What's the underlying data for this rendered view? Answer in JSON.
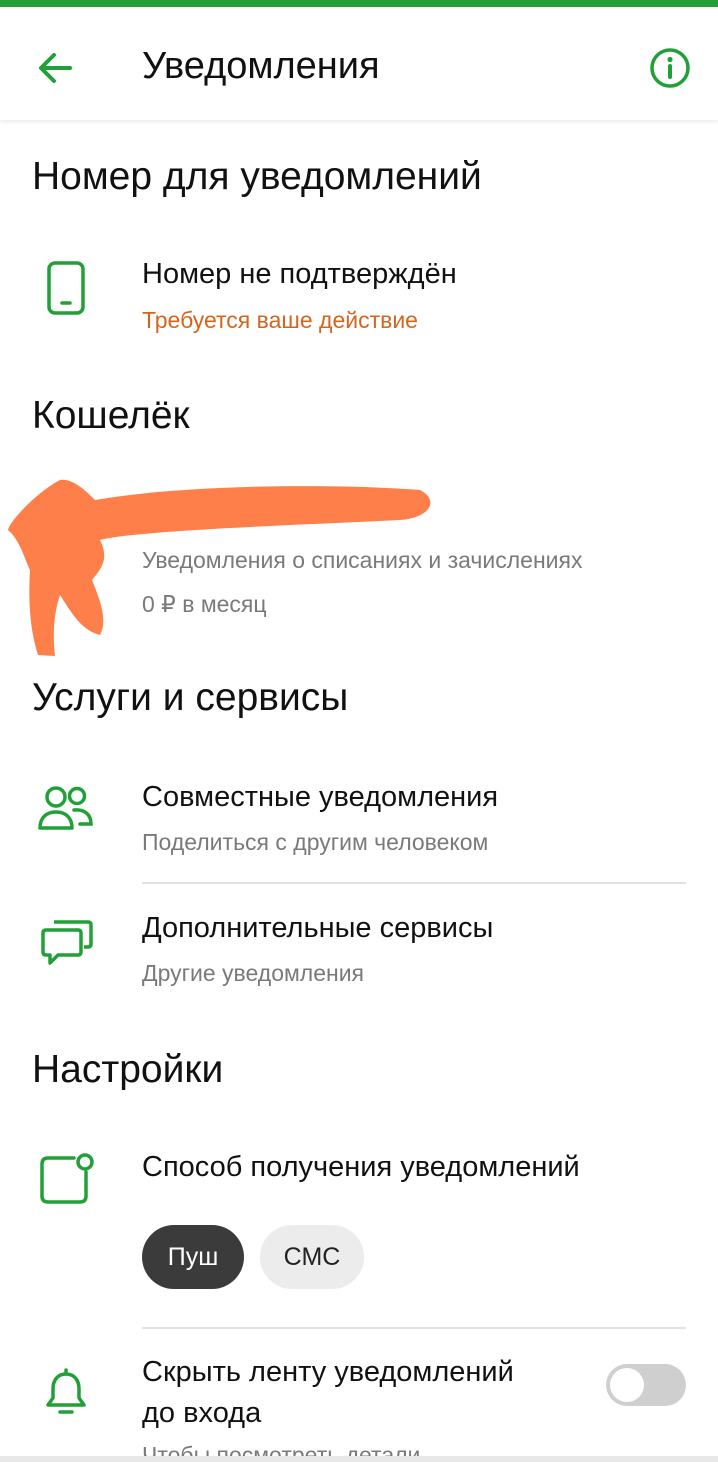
{
  "header": {
    "title": "Уведомления"
  },
  "colors": {
    "accent": "#21a038",
    "warning": "#d3661f",
    "scribble": "#ff7f4a"
  },
  "sections": {
    "phone": {
      "title": "Номер для уведомлений",
      "row_title": "Номер не подтверждён",
      "row_sub": "Требуется ваше действие",
      "icon": "phone-icon"
    },
    "wallet": {
      "title": "Кошелёк",
      "row_sub": "Уведомления о списаниях и зачислениях",
      "row_price": "0 ₽ в месяц"
    },
    "services": {
      "title": "Услуги и сервисы",
      "items": [
        {
          "title": "Совместные уведомления",
          "sub": "Поделиться с другим человеком",
          "icon": "users-icon"
        },
        {
          "title": "Дополнительные сервисы",
          "sub": "Другие уведомления",
          "icon": "chat-icon"
        }
      ]
    },
    "settings": {
      "title": "Настройки",
      "delivery_title": "Способ получения уведомлений",
      "delivery_icon": "notification-dot-icon",
      "options": [
        "Пуш",
        "СМС"
      ],
      "selected_option": "Пуш",
      "hide_feed_title_line1": "Скрыть ленту уведомлений",
      "hide_feed_title_line2": "до входа",
      "hide_feed_sub": "Чтобы посмотреть детали",
      "hide_feed_icon": "bell-icon",
      "hide_feed_enabled": false
    }
  }
}
